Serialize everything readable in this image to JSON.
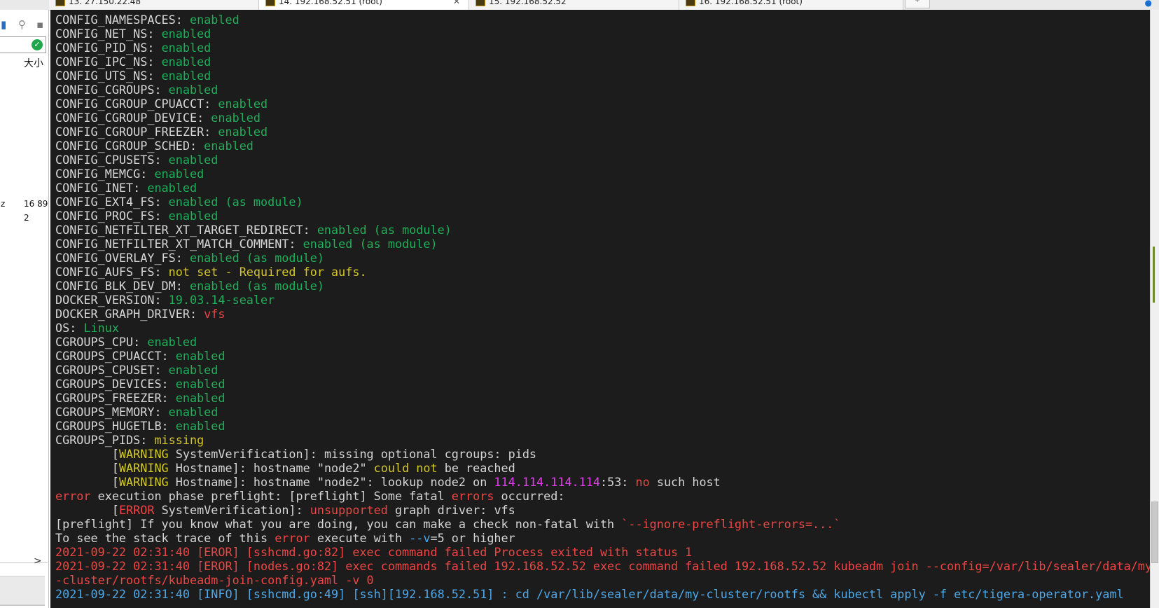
{
  "tabs": [
    {
      "label": "13. 27.150.22.48",
      "active": false
    },
    {
      "label": "14. 192.168.52.51 (root)",
      "active": true
    },
    {
      "label": "15. 192.168.52.52",
      "active": false
    },
    {
      "label": "16. 192.168.52.51 (root)",
      "active": false
    }
  ],
  "sidepanel": {
    "size_label": "大小",
    "z_label": "z",
    "number": "16 89",
    "number2": "2",
    "arrow": ">"
  },
  "terminal": {
    "lines": [
      [
        {
          "t": "CONFIG_NAMESPACES: ",
          "c": "w"
        },
        {
          "t": "enabled",
          "c": "g"
        }
      ],
      [
        {
          "t": "CONFIG_NET_NS: ",
          "c": "w"
        },
        {
          "t": "enabled",
          "c": "g"
        }
      ],
      [
        {
          "t": "CONFIG_PID_NS: ",
          "c": "w"
        },
        {
          "t": "enabled",
          "c": "g"
        }
      ],
      [
        {
          "t": "CONFIG_IPC_NS: ",
          "c": "w"
        },
        {
          "t": "enabled",
          "c": "g"
        }
      ],
      [
        {
          "t": "CONFIG_UTS_NS: ",
          "c": "w"
        },
        {
          "t": "enabled",
          "c": "g"
        }
      ],
      [
        {
          "t": "CONFIG_CGROUPS: ",
          "c": "w"
        },
        {
          "t": "enabled",
          "c": "g"
        }
      ],
      [
        {
          "t": "CONFIG_CGROUP_CPUACCT: ",
          "c": "w"
        },
        {
          "t": "enabled",
          "c": "g"
        }
      ],
      [
        {
          "t": "CONFIG_CGROUP_DEVICE: ",
          "c": "w"
        },
        {
          "t": "enabled",
          "c": "g"
        }
      ],
      [
        {
          "t": "CONFIG_CGROUP_FREEZER: ",
          "c": "w"
        },
        {
          "t": "enabled",
          "c": "g"
        }
      ],
      [
        {
          "t": "CONFIG_CGROUP_SCHED: ",
          "c": "w"
        },
        {
          "t": "enabled",
          "c": "g"
        }
      ],
      [
        {
          "t": "CONFIG_CPUSETS: ",
          "c": "w"
        },
        {
          "t": "enabled",
          "c": "g"
        }
      ],
      [
        {
          "t": "CONFIG_MEMCG: ",
          "c": "w"
        },
        {
          "t": "enabled",
          "c": "g"
        }
      ],
      [
        {
          "t": "CONFIG_INET: ",
          "c": "w"
        },
        {
          "t": "enabled",
          "c": "g"
        }
      ],
      [
        {
          "t": "CONFIG_EXT4_FS: ",
          "c": "w"
        },
        {
          "t": "enabled (as module)",
          "c": "g"
        }
      ],
      [
        {
          "t": "CONFIG_PROC_FS: ",
          "c": "w"
        },
        {
          "t": "enabled",
          "c": "g"
        }
      ],
      [
        {
          "t": "CONFIG_NETFILTER_XT_TARGET_REDIRECT: ",
          "c": "w"
        },
        {
          "t": "enabled (as module)",
          "c": "g"
        }
      ],
      [
        {
          "t": "CONFIG_NETFILTER_XT_MATCH_COMMENT: ",
          "c": "w"
        },
        {
          "t": "enabled (as module)",
          "c": "g"
        }
      ],
      [
        {
          "t": "CONFIG_OVERLAY_FS: ",
          "c": "w"
        },
        {
          "t": "enabled (as module)",
          "c": "g"
        }
      ],
      [
        {
          "t": "CONFIG_AUFS_FS: ",
          "c": "w"
        },
        {
          "t": "not set - Required for aufs.",
          "c": "y"
        }
      ],
      [
        {
          "t": "CONFIG_BLK_DEV_DM: ",
          "c": "w"
        },
        {
          "t": "enabled (as module)",
          "c": "g"
        }
      ],
      [
        {
          "t": "DOCKER_VERSION: ",
          "c": "w"
        },
        {
          "t": "19.03.14-sealer",
          "c": "g"
        }
      ],
      [
        {
          "t": "DOCKER_GRAPH_DRIVER: ",
          "c": "w"
        },
        {
          "t": "vfs",
          "c": "r"
        }
      ],
      [
        {
          "t": "OS: ",
          "c": "w"
        },
        {
          "t": "Linux",
          "c": "g"
        }
      ],
      [
        {
          "t": "CGROUPS_CPU: ",
          "c": "w"
        },
        {
          "t": "enabled",
          "c": "g"
        }
      ],
      [
        {
          "t": "CGROUPS_CPUACCT: ",
          "c": "w"
        },
        {
          "t": "enabled",
          "c": "g"
        }
      ],
      [
        {
          "t": "CGROUPS_CPUSET: ",
          "c": "w"
        },
        {
          "t": "enabled",
          "c": "g"
        }
      ],
      [
        {
          "t": "CGROUPS_DEVICES: ",
          "c": "w"
        },
        {
          "t": "enabled",
          "c": "g"
        }
      ],
      [
        {
          "t": "CGROUPS_FREEZER: ",
          "c": "w"
        },
        {
          "t": "enabled",
          "c": "g"
        }
      ],
      [
        {
          "t": "CGROUPS_MEMORY: ",
          "c": "w"
        },
        {
          "t": "enabled",
          "c": "g"
        }
      ],
      [
        {
          "t": "CGROUPS_HUGETLB: ",
          "c": "w"
        },
        {
          "t": "enabled",
          "c": "g"
        }
      ],
      [
        {
          "t": "CGROUPS_PIDS: ",
          "c": "w"
        },
        {
          "t": "missing",
          "c": "y"
        }
      ],
      [
        {
          "t": "        [",
          "c": "w"
        },
        {
          "t": "WARNING",
          "c": "y"
        },
        {
          "t": " SystemVerification]: missing optional cgroups: pids",
          "c": "w"
        }
      ],
      [
        {
          "t": "        [",
          "c": "w"
        },
        {
          "t": "WARNING",
          "c": "y"
        },
        {
          "t": " Hostname]: hostname \"node2\" ",
          "c": "w"
        },
        {
          "t": "could not",
          "c": "y"
        },
        {
          "t": " be reached",
          "c": "w"
        }
      ],
      [
        {
          "t": "        [",
          "c": "w"
        },
        {
          "t": "WARNING",
          "c": "y"
        },
        {
          "t": " Hostname]: hostname \"node2\": lookup node2 on ",
          "c": "w"
        },
        {
          "t": "114.114.114.114",
          "c": "m"
        },
        {
          "t": ":53: ",
          "c": "w"
        },
        {
          "t": "no",
          "c": "r"
        },
        {
          "t": " such host",
          "c": "w"
        }
      ],
      [
        {
          "t": "error",
          "c": "r"
        },
        {
          "t": " execution phase preflight: [preflight] Some fatal ",
          "c": "w"
        },
        {
          "t": "errors",
          "c": "r"
        },
        {
          "t": " occurred:",
          "c": "w"
        }
      ],
      [
        {
          "t": "        [",
          "c": "w"
        },
        {
          "t": "ERROR",
          "c": "r"
        },
        {
          "t": " SystemVerification]: ",
          "c": "w"
        },
        {
          "t": "unsupported",
          "c": "r"
        },
        {
          "t": " graph driver: vfs",
          "c": "w"
        }
      ],
      [
        {
          "t": "[preflight] If you know what you are doing, you can make a check non-fatal with ",
          "c": "w"
        },
        {
          "t": "`--ignore-preflight-errors=...`",
          "c": "r"
        }
      ],
      [
        {
          "t": "To see the stack trace of this ",
          "c": "w"
        },
        {
          "t": "error",
          "c": "r"
        },
        {
          "t": " execute with ",
          "c": "w"
        },
        {
          "t": "--v",
          "c": "c"
        },
        {
          "t": "=5 or higher",
          "c": "w"
        }
      ],
      [
        {
          "t": "2021-09-22 02:31:40 [EROR] [sshcmd.go:82] exec command failed Process exited with status 1",
          "c": "r"
        }
      ],
      [
        {
          "t": "2021-09-22 02:31:40 [EROR] [nodes.go:82] exec commands failed 192.168.52.52 exec command failed 192.168.52.52 kubeadm join --config=/var/lib/sealer/data/my",
          "c": "r"
        }
      ],
      [
        {
          "t": "-cluster/rootfs/kubeadm-join-config.yaml -v 0",
          "c": "r"
        }
      ],
      [
        {
          "t": "2021-09-22 02:31:40 [INFO] [sshcmd.go:49] [ssh][192.168.52.51] : cd /var/lib/sealer/data/my-cluster/rootfs && kubectl apply -f etc/tigera-operator.yaml",
          "c": "c"
        }
      ]
    ]
  }
}
